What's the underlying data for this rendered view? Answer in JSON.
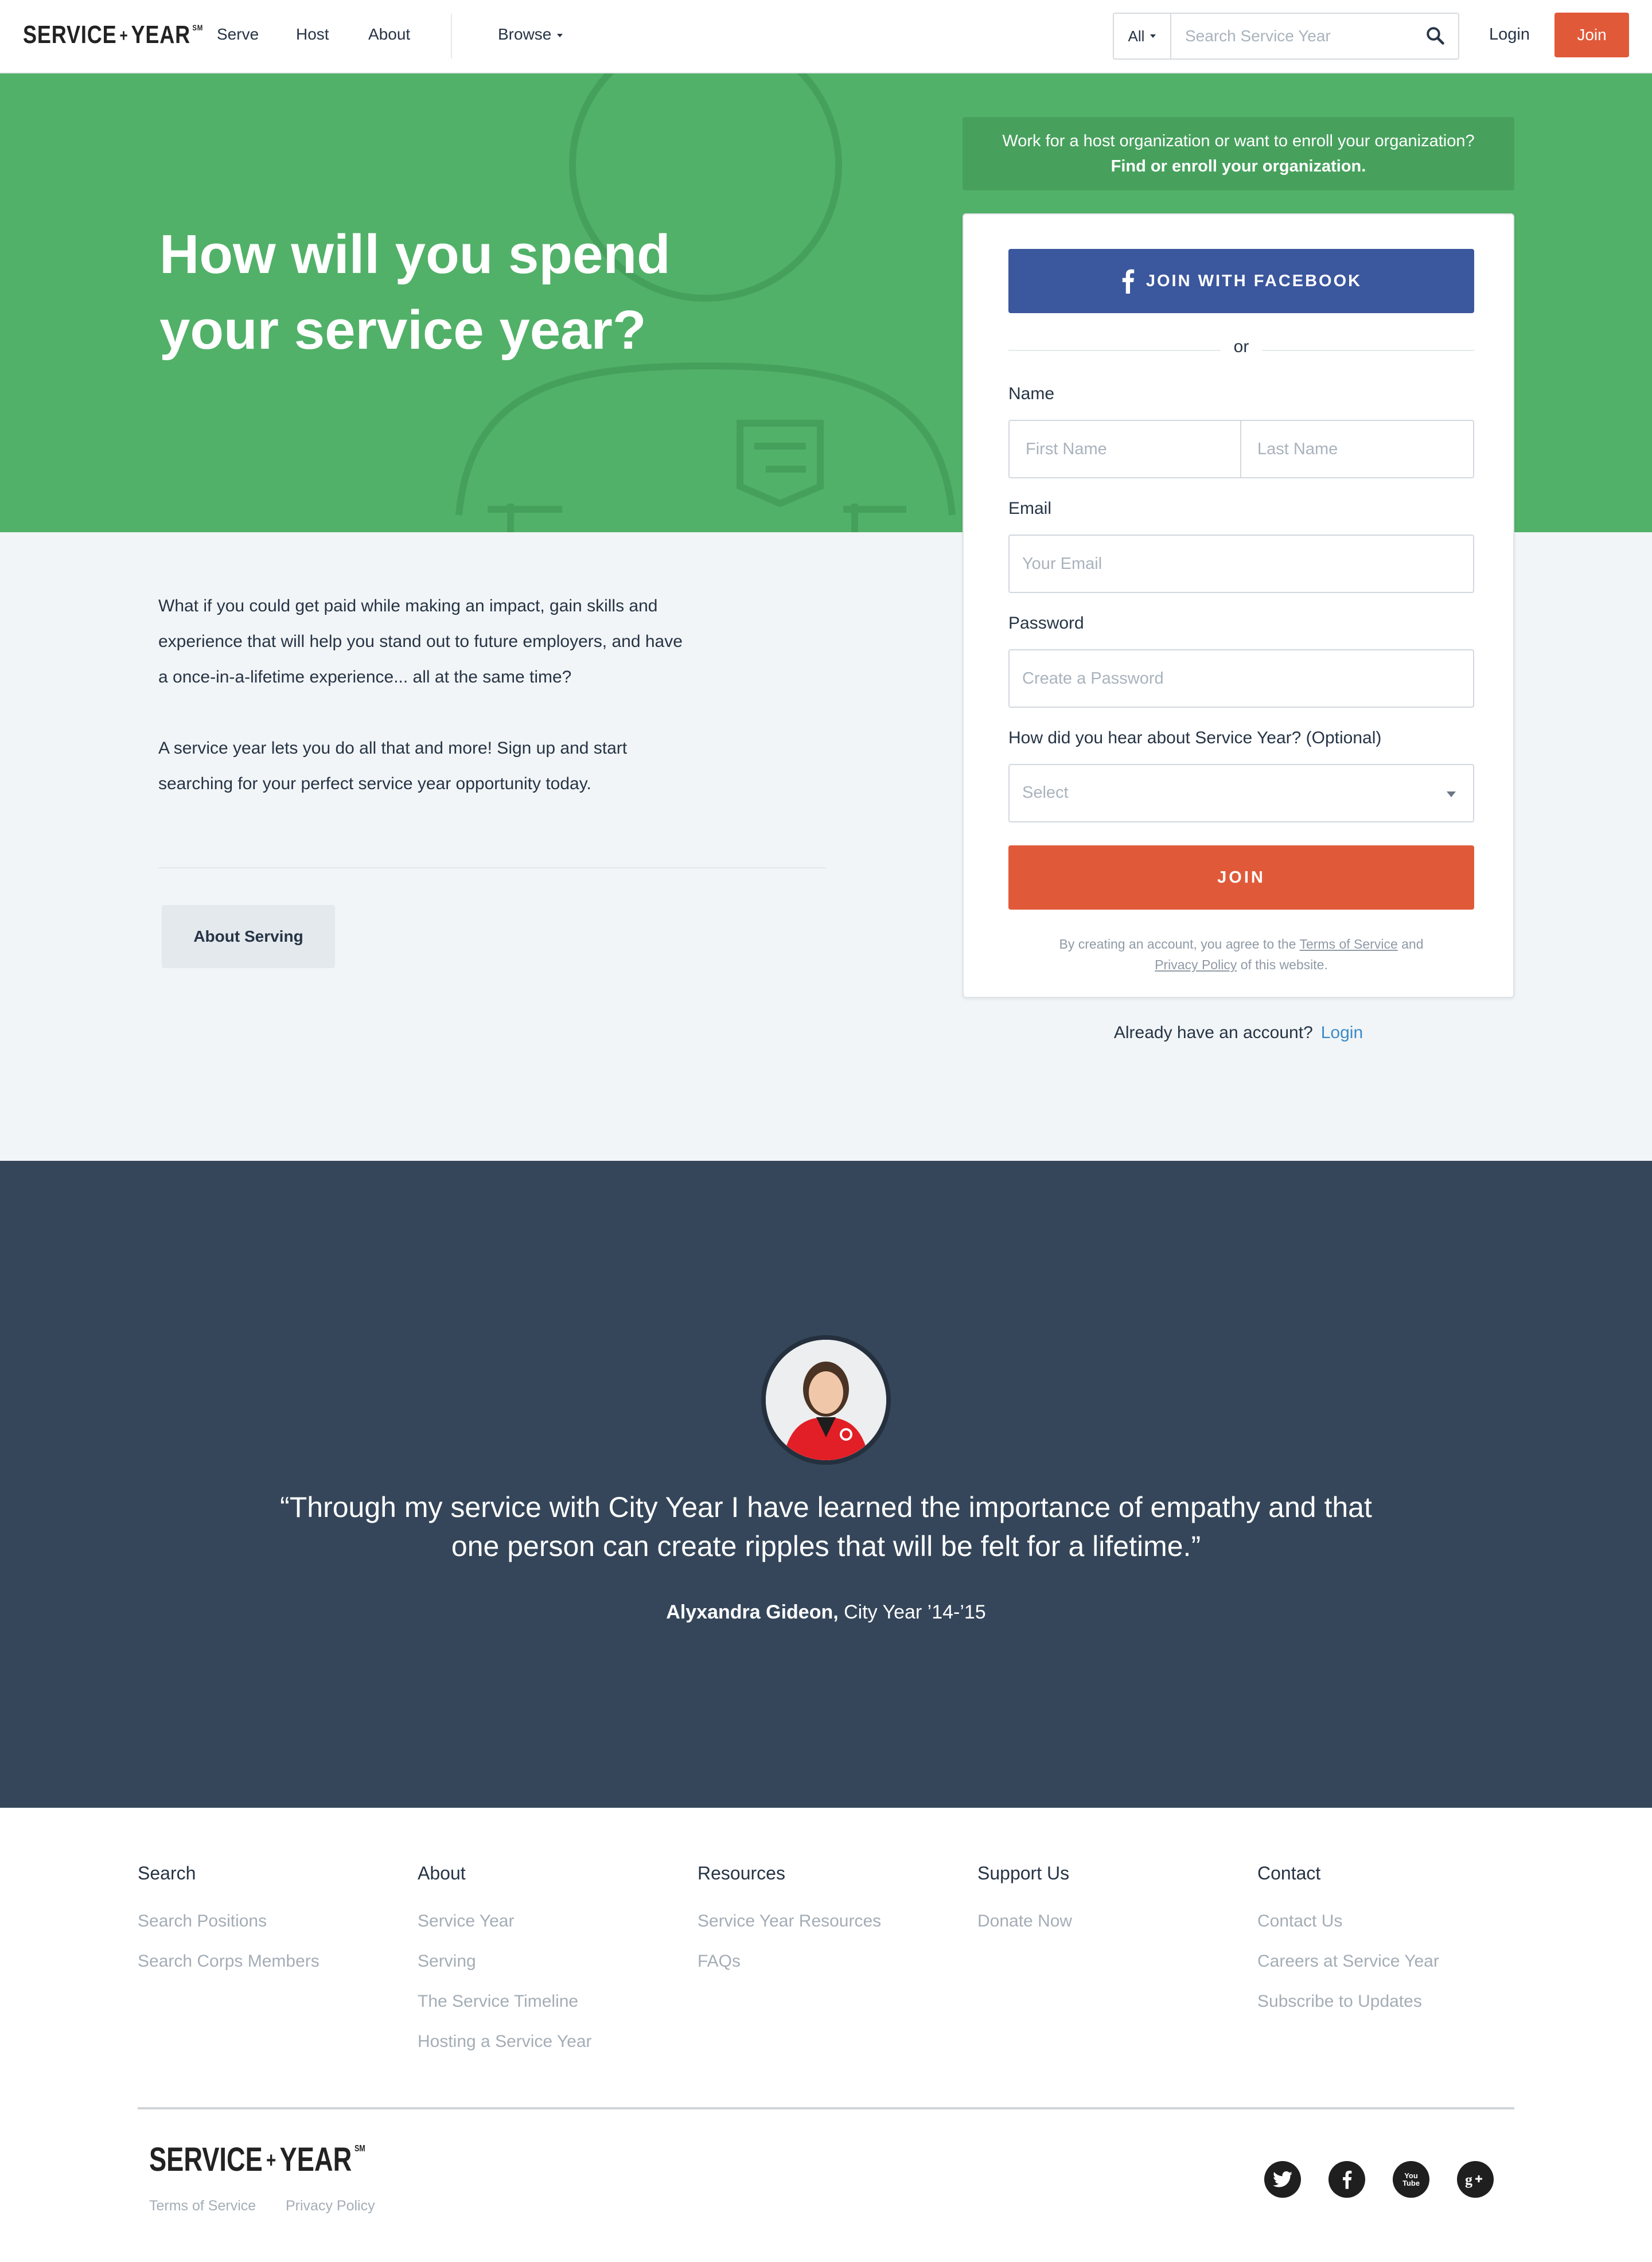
{
  "header": {
    "logo": {
      "word1": "SERVICE",
      "plus": "+",
      "word2": "YEAR",
      "mark": "SM"
    },
    "nav": [
      "Serve",
      "Host",
      "About"
    ],
    "browse_label": "Browse",
    "search": {
      "scope": "All",
      "placeholder": "Search Service Year",
      "icon": "search-icon"
    },
    "login_label": "Login",
    "join_label": "Join"
  },
  "hero": {
    "title_line1": "How will you spend",
    "title_line2": "your service year?",
    "host_banner_text": "Work for a host organization or want to enroll your organization?",
    "host_banner_link": "Find or enroll your organization."
  },
  "signup": {
    "facebook_label": "JOIN WITH FACEBOOK",
    "or_label": "or",
    "name_label": "Name",
    "first_name_placeholder": "First Name",
    "last_name_placeholder": "Last Name",
    "email_label": "Email",
    "email_placeholder": "Your Email",
    "password_label": "Password",
    "password_placeholder": "Create a Password",
    "referral_label": "How did you hear about Service Year? (Optional)",
    "referral_value": "Select",
    "join_label": "JOIN",
    "legal_prefix": "By creating an account, you agree to the",
    "legal_tos": "Terms of Service",
    "legal_and": "and",
    "legal_privacy": "Privacy Policy",
    "legal_suffix": "of this website.",
    "already_text": "Already have an account?",
    "already_login": "Login"
  },
  "intro": {
    "paragraph1": "What if you could get paid while making an impact, gain skills and experience that will help you stand out to future employers, and have a once-in-a-lifetime experience... all at the same time?",
    "paragraph2": "A service year lets you do all that and more! Sign up and start searching for your perfect service year opportunity today.",
    "button_label": "About Serving"
  },
  "testimonial": {
    "quote": "“Through my service with City Year I have learned the importance of empathy and that one person can create ripples that will be felt for a lifetime.”",
    "name": "Alyxandra Gideon,",
    "affiliation": "City Year ’14-’15"
  },
  "footer": {
    "columns": [
      {
        "title": "Search",
        "links": [
          "Search Positions",
          "Search Corps Members"
        ]
      },
      {
        "title": "About",
        "links": [
          "Service Year",
          "Serving",
          "The Service Timeline",
          "Hosting a Service Year"
        ]
      },
      {
        "title": "Resources",
        "links": [
          "Service Year Resources",
          "FAQs"
        ]
      },
      {
        "title": "Support Us",
        "links": [
          "Donate Now"
        ]
      },
      {
        "title": "Contact",
        "links": [
          "Contact Us",
          "Careers at Service Year",
          "Subscribe to Updates"
        ]
      }
    ],
    "logo": {
      "word1": "SERVICE",
      "plus": "+",
      "word2": "YEAR",
      "mark": "SM"
    },
    "terms_label": "Terms of Service",
    "privacy_label": "Privacy Policy",
    "social": [
      "twitter-icon",
      "facebook-icon",
      "youtube-icon",
      "google-plus-icon"
    ],
    "youtube_text": "You Tube"
  },
  "colors": {
    "hero_green": "#51b168",
    "banner_green": "#47a15d",
    "accent_orange": "#e05a3a",
    "facebook_blue": "#3b579d",
    "testimonial_navy": "#35465a",
    "link_blue": "#3b8bc9"
  }
}
